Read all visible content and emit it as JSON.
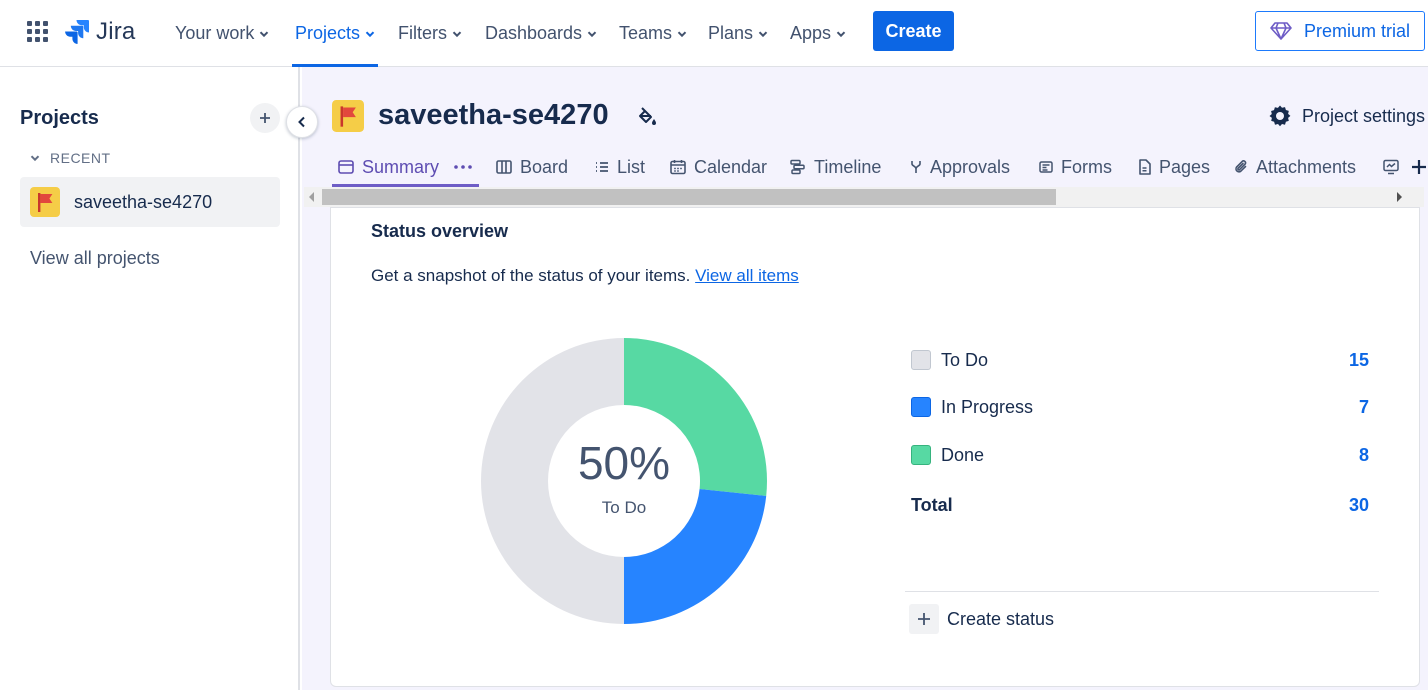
{
  "topnav": {
    "brand": "Jira",
    "items": [
      {
        "label": "Your work",
        "active": false
      },
      {
        "label": "Projects",
        "active": true
      },
      {
        "label": "Filters",
        "active": false
      },
      {
        "label": "Dashboards",
        "active": false
      },
      {
        "label": "Teams",
        "active": false
      },
      {
        "label": "Plans",
        "active": false
      },
      {
        "label": "Apps",
        "active": false
      }
    ],
    "create_label": "Create",
    "premium_label": "Premium trial"
  },
  "sidebar": {
    "title": "Projects",
    "recent_label": "RECENT",
    "project_name": "saveetha-se4270",
    "view_all": "View all projects"
  },
  "project": {
    "name": "saveetha-se4270",
    "settings_label": "Project settings"
  },
  "tabs": [
    {
      "label": "Summary",
      "icon": "summary-icon",
      "active": true
    },
    {
      "label": "Board",
      "icon": "board-icon",
      "active": false
    },
    {
      "label": "List",
      "icon": "list-icon",
      "active": false
    },
    {
      "label": "Calendar",
      "icon": "calendar-icon",
      "active": false
    },
    {
      "label": "Timeline",
      "icon": "timeline-icon",
      "active": false
    },
    {
      "label": "Approvals",
      "icon": "approvals-icon",
      "active": false
    },
    {
      "label": "Forms",
      "icon": "forms-icon",
      "active": false
    },
    {
      "label": "Pages",
      "icon": "pages-icon",
      "active": false
    },
    {
      "label": "Attachments",
      "icon": "attachments-icon",
      "active": false
    }
  ],
  "status_overview": {
    "title": "Status overview",
    "description": "Get a snapshot of the status of your items.",
    "link": "View all items",
    "center_percent": "50%",
    "center_label": "To Do",
    "total_label": "Total",
    "total_value": "30",
    "create_status": "Create status"
  },
  "chart_data": {
    "type": "pie",
    "categories": [
      "To Do",
      "In Progress",
      "Done"
    ],
    "values": [
      15,
      7,
      8
    ],
    "colors": [
      "#e2e3e8",
      "#2684ff",
      "#57d9a3"
    ],
    "donut": true
  }
}
